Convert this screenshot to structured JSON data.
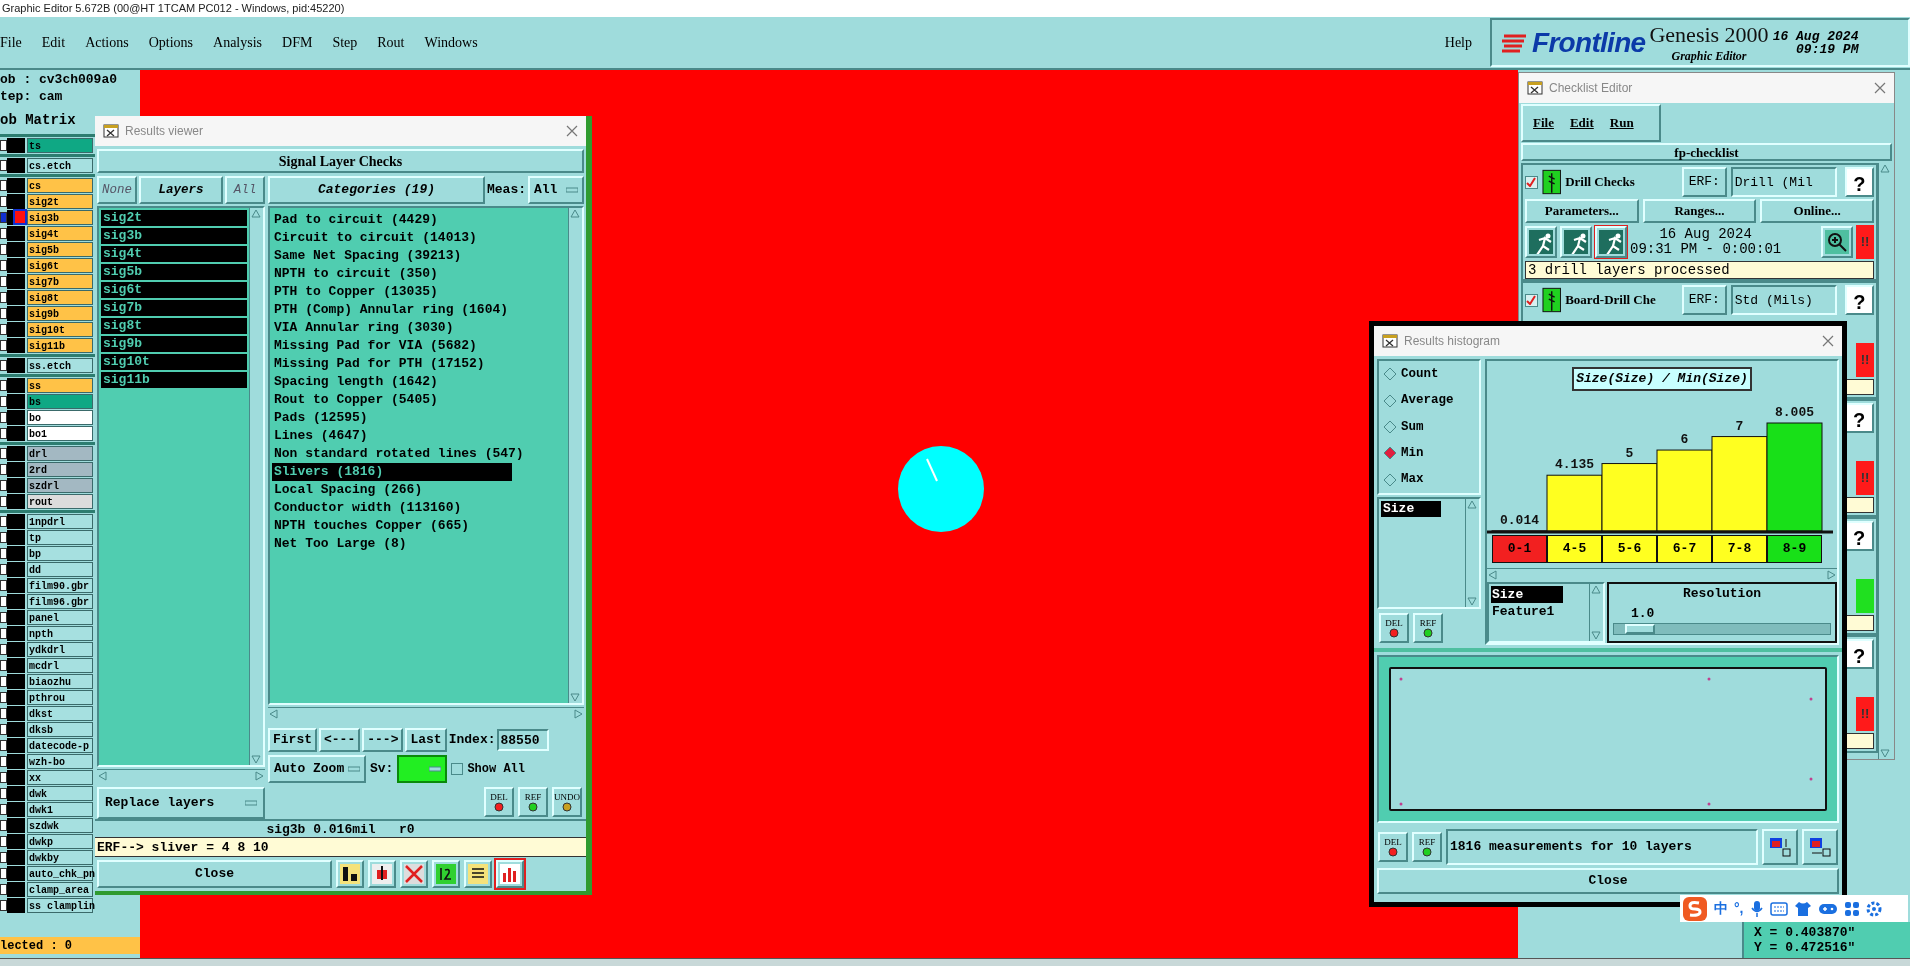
{
  "app_title": "Graphic Editor 5.672B (00@HT 1TCAM PC012 - Windows, pid:45220)",
  "menu": [
    "File",
    "Edit",
    "Actions",
    "Options",
    "Analysis",
    "DFM",
    "Step",
    "Rout",
    "Windows"
  ],
  "help": "Help",
  "brand": {
    "logo": "Frontline",
    "product": "Genesis 2000",
    "subtitle": "Graphic Editor",
    "date": "16 Aug 2024",
    "time": "09:19 PM"
  },
  "job_panel": {
    "job": "ob : cv3ch009a0",
    "step": "tep: cam",
    "matrix_title": "ob Matrix",
    "groups": [
      [
        {
          "name": "ts",
          "color": "#0fa884",
          "checked": false,
          "work": false
        }
      ],
      [
        {
          "name": "cs.etch",
          "color": "#a6e0e0",
          "checked": false,
          "work": false
        }
      ],
      [
        {
          "name": "cs",
          "color": "#ffc247",
          "checked": false,
          "work": false
        },
        {
          "name": "sig2t",
          "color": "#ffc247",
          "checked": false,
          "work": false
        },
        {
          "name": "sig3b",
          "color": "#ffc247",
          "checked": true,
          "work": true
        },
        {
          "name": "sig4t",
          "color": "#ffc247",
          "checked": false,
          "work": false
        },
        {
          "name": "sig5b",
          "color": "#ffc247",
          "checked": false,
          "work": false
        },
        {
          "name": "sig6t",
          "color": "#ffc247",
          "checked": false,
          "work": false
        },
        {
          "name": "sig7b",
          "color": "#ffc247",
          "checked": false,
          "work": false
        },
        {
          "name": "sig8t",
          "color": "#ffc247",
          "checked": false,
          "work": false
        },
        {
          "name": "sig9b",
          "color": "#ffc247",
          "checked": false,
          "work": false
        },
        {
          "name": "sig10t",
          "color": "#ffc247",
          "checked": false,
          "work": false
        },
        {
          "name": "sig11b",
          "color": "#ffc247",
          "checked": false,
          "work": false
        }
      ],
      [
        {
          "name": "ss.etch",
          "color": "#a6e0e0",
          "checked": false,
          "work": false
        }
      ],
      [
        {
          "name": "ss",
          "color": "#ffc247",
          "checked": false,
          "work": false
        },
        {
          "name": "bs",
          "color": "#0fa884",
          "checked": false,
          "work": false
        },
        {
          "name": "bo",
          "color": "#ffffff",
          "checked": false,
          "work": false
        },
        {
          "name": "bo1",
          "color": "#ffffff",
          "checked": false,
          "work": false
        }
      ],
      [
        {
          "name": "drl",
          "color": "#a3b8c2",
          "checked": false,
          "work": false
        },
        {
          "name": "2rd",
          "color": "#a3b8c2",
          "checked": false,
          "work": false
        },
        {
          "name": "szdrl",
          "color": "#a3b8c2",
          "checked": false,
          "work": false
        },
        {
          "name": "rout",
          "color": "#dcdcdc",
          "checked": false,
          "work": false
        }
      ],
      [
        {
          "name": "1npdrl",
          "color": "#a6e0e0",
          "checked": false,
          "work": false
        },
        {
          "name": "tp",
          "color": "#a6e0e0",
          "checked": false,
          "work": false
        },
        {
          "name": "bp",
          "color": "#a6e0e0",
          "checked": false,
          "work": false
        },
        {
          "name": "dd",
          "color": "#a6e0e0",
          "checked": false,
          "work": false
        },
        {
          "name": "film90.gbr",
          "color": "#a6e0e0",
          "checked": false,
          "work": false
        },
        {
          "name": "film96.gbr",
          "color": "#a6e0e0",
          "checked": false,
          "work": false
        },
        {
          "name": "panel",
          "color": "#a6e0e0",
          "checked": false,
          "work": false
        },
        {
          "name": "npth",
          "color": "#a6e0e0",
          "checked": false,
          "work": false
        },
        {
          "name": "ydkdrl",
          "color": "#a6e0e0",
          "checked": false,
          "work": false
        },
        {
          "name": "mcdrl",
          "color": "#a6e0e0",
          "checked": false,
          "work": false
        },
        {
          "name": "biaozhu",
          "color": "#a6e0e0",
          "checked": false,
          "work": false
        },
        {
          "name": "pthrou",
          "color": "#a6e0e0",
          "checked": false,
          "work": false
        },
        {
          "name": "dkst",
          "color": "#a6e0e0",
          "checked": false,
          "work": false
        },
        {
          "name": "dksb",
          "color": "#a6e0e0",
          "checked": false,
          "work": false
        },
        {
          "name": "datecode-p",
          "color": "#a6e0e0",
          "checked": false,
          "work": false
        },
        {
          "name": "wzh-bo",
          "color": "#a6e0e0",
          "checked": false,
          "work": false
        },
        {
          "name": "xx",
          "color": "#a6e0e0",
          "checked": false,
          "work": false
        },
        {
          "name": "dwk",
          "color": "#a6e0e0",
          "checked": false,
          "work": false
        },
        {
          "name": "dwk1",
          "color": "#a6e0e0",
          "checked": false,
          "work": false
        },
        {
          "name": "szdwk",
          "color": "#a6e0e0",
          "checked": false,
          "work": false
        },
        {
          "name": "dwkp",
          "color": "#a6e0e0",
          "checked": false,
          "work": false
        },
        {
          "name": "dwkby",
          "color": "#a6e0e0",
          "checked": false,
          "work": false
        },
        {
          "name": "auto_chk_pn",
          "color": "#a6e0e0",
          "checked": false,
          "work": false
        },
        {
          "name": "clamp_area",
          "color": "#a6e0e0",
          "checked": false,
          "work": false
        },
        {
          "name": "ss clamplin",
          "color": "#a6e0e0",
          "checked": false,
          "work": false
        }
      ]
    ],
    "selected_count": "lected : 0"
  },
  "results_viewer": {
    "title": "Results viewer",
    "header": "Signal Layer Checks",
    "layer_buttons": [
      "None",
      "Layers",
      "All"
    ],
    "layers": [
      {
        "name": "sig2t",
        "selected": true
      },
      {
        "name": "sig3b",
        "selected": true
      },
      {
        "name": "sig4t",
        "selected": true
      },
      {
        "name": "sig5b",
        "selected": true
      },
      {
        "name": "sig6t",
        "selected": true
      },
      {
        "name": "sig7b",
        "selected": true
      },
      {
        "name": "sig8t",
        "selected": true
      },
      {
        "name": "sig9b",
        "selected": true
      },
      {
        "name": "sig10t",
        "selected": true
      },
      {
        "name": "sig11b",
        "selected": true
      }
    ],
    "categories_button": "Categories (19)",
    "meas_label": "Meas:",
    "meas_value": "All",
    "categories": [
      {
        "label": "Pad to circuit (4429)",
        "selected": false
      },
      {
        "label": "Circuit to circuit (14013)",
        "selected": false
      },
      {
        "label": "Same Net Spacing (39213)",
        "selected": false
      },
      {
        "label": "NPTH to circuit (350)",
        "selected": false
      },
      {
        "label": "PTH to Copper (13035)",
        "selected": false
      },
      {
        "label": "PTH (Comp) Annular ring (1604)",
        "selected": false
      },
      {
        "label": "VIA Annular ring (3030)",
        "selected": false
      },
      {
        "label": "Missing Pad for VIA (5682)",
        "selected": false
      },
      {
        "label": "Missing Pad for PTH (17152)",
        "selected": false
      },
      {
        "label": "Spacing length (1642)",
        "selected": false
      },
      {
        "label": "Rout to Copper (5405)",
        "selected": false
      },
      {
        "label": "Pads (12595)",
        "selected": false
      },
      {
        "label": "Lines (4647)",
        "selected": false
      },
      {
        "label": "Non standard rotated lines (547)",
        "selected": false
      },
      {
        "label": "Slivers (1816)",
        "selected": true
      },
      {
        "label": "Local Spacing (266)",
        "selected": false
      },
      {
        "label": "Conductor width (113160)",
        "selected": false
      },
      {
        "label": "NPTH touches Copper (665)",
        "selected": false
      },
      {
        "label": "Net Too Large (8)",
        "selected": false
      }
    ],
    "nav_buttons": [
      "First",
      "<---",
      "--->",
      "Last"
    ],
    "index_label": "Index:",
    "index_value": "88550",
    "zoom_mode": "Auto Zoom",
    "sv_label": "Sv:",
    "show_all": {
      "label": "Show All",
      "checked": false
    },
    "action_buttons": [
      "DEL",
      "REF",
      "UNDO"
    ],
    "layer_mode": "Replace layers",
    "status": "sig3b 0.016mil   r0",
    "erf": "ERF--> sliver = 4 8 10",
    "close": "Close"
  },
  "checklist_editor": {
    "title": "Checklist Editor",
    "menu": [
      "File",
      "Edit",
      "Run"
    ],
    "name": "fp-checklist",
    "rows": [
      {
        "name": "Drill Checks",
        "checked": true,
        "erf_label": "ERF:",
        "erf_value": "Drill (Mil",
        "help": "?",
        "buttons": [
          "Parameters...",
          "Ranges...",
          "Online..."
        ],
        "date": "16 Aug 2024",
        "time": "09:31 PM - 0:00:01",
        "message": "3 drill layers processed",
        "kind": "fail",
        "status_text": "!!"
      },
      {
        "name": "Board-Drill Che",
        "checked": true,
        "erf_label": "ERF:",
        "erf_value": "Std (Mils)",
        "help": "?",
        "kind": "fail",
        "status_text": "!!"
      },
      {
        "help": "?",
        "kind": "fail",
        "status_text": "!!"
      },
      {
        "help": "?",
        "kind": "pass"
      },
      {
        "help": "?",
        "kind": "fail",
        "status_text": "!!"
      }
    ]
  },
  "histogram": {
    "title": "Results histogram",
    "functions": [
      {
        "label": "Count",
        "selected": false
      },
      {
        "label": "Average",
        "selected": false
      },
      {
        "label": "Sum",
        "selected": false
      },
      {
        "label": "Min",
        "selected": true
      },
      {
        "label": "Max",
        "selected": false
      }
    ],
    "attributes": [
      {
        "label": "Size",
        "selected": true
      }
    ],
    "buttons": [
      "DEL",
      "REF"
    ],
    "chart_data": {
      "type": "bar",
      "title": "Size(Size) / Min(Size)",
      "categories": [
        "0-1",
        "4-5",
        "5-6",
        "6-7",
        "7-8",
        "8-9"
      ],
      "series": [
        {
          "values": [
            0.014,
            4.135,
            5,
            6,
            7,
            8.005
          ]
        }
      ],
      "data_labels": true
    },
    "bins": [
      {
        "color": "#f22020"
      },
      {
        "color": "#ffff20"
      },
      {
        "color": "#ffff20"
      },
      {
        "color": "#ffff20"
      },
      {
        "color": "#ffff20"
      },
      {
        "color": "#18e018"
      }
    ],
    "fields": [
      {
        "label": "Size",
        "selected": true
      },
      {
        "label": "Feature1",
        "selected": false
      }
    ],
    "resolution": {
      "label": "Resolution",
      "value": "1.0",
      "level": 0.05
    },
    "footer_buttons": [
      "DEL",
      "REF"
    ],
    "message": "1816 measurements for 10 layers",
    "close": "Close"
  },
  "ime_bar": {
    "mode": "中",
    "punctuation": "°,"
  },
  "coordinates": [
    "X = 0.403870\"",
    "Y = 0.472516\""
  ]
}
